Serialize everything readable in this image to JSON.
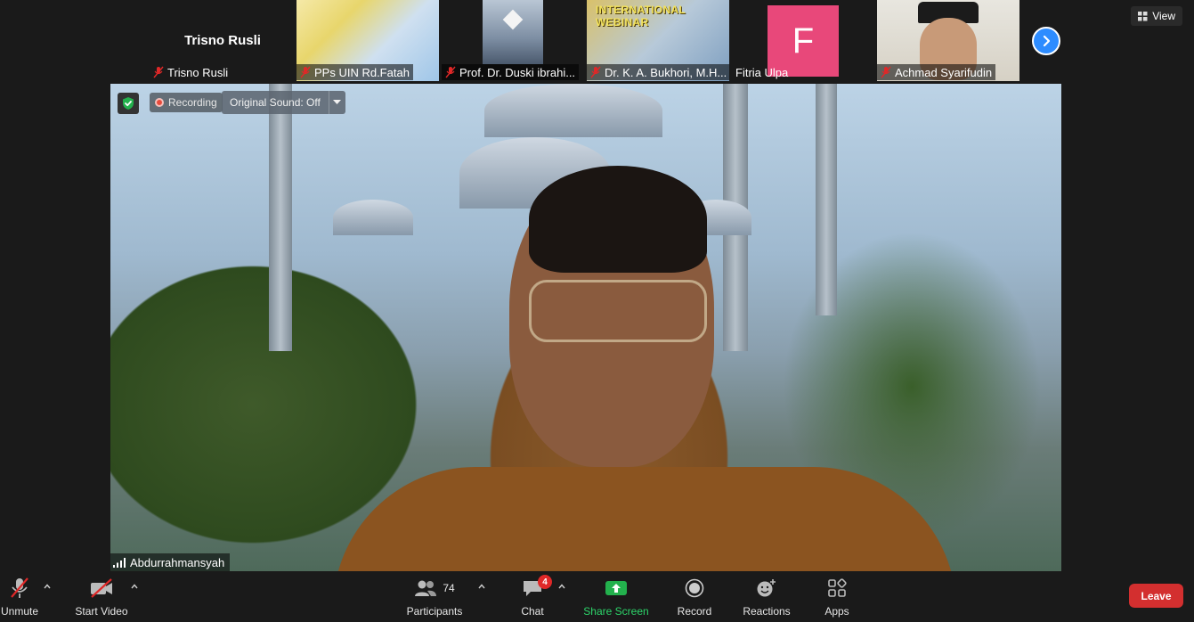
{
  "top_strip": {
    "participants": [
      {
        "name": "Trisno Rusli",
        "display": "Trisno Rusli",
        "muted": true
      },
      {
        "name": "PPs UIN Rd.Fatah",
        "muted": true
      },
      {
        "name": "Prof. Dr. Duski ibrahi...",
        "muted": true
      },
      {
        "name": "Dr. K. A. Bukhori, M.H...",
        "muted": true,
        "banner": "INTERNATIONAL WEBINAR"
      },
      {
        "name": "Fitria Ulpa",
        "muted": false,
        "avatar_letter": "F"
      },
      {
        "name": "Achmad Syarifudin",
        "muted": true
      }
    ],
    "next_icon": "chevron-right-icon",
    "view_label": "View"
  },
  "stage": {
    "recording_label": "Recording",
    "original_sound_label": "Original Sound: Off",
    "speaker_name": "Abdurrahmansyah",
    "security_icon": "shield-check-icon"
  },
  "toolbar": {
    "unmute_label": "Unmute",
    "start_video_label": "Start Video",
    "participants_label": "Participants",
    "participants_count": "74",
    "chat_label": "Chat",
    "chat_badge": "4",
    "share_screen_label": "Share Screen",
    "record_label": "Record",
    "reactions_label": "Reactions",
    "apps_label": "Apps",
    "leave_label": "Leave"
  },
  "colors": {
    "accent_blue": "#2d8cff",
    "leave_red": "#d32f2f",
    "share_green": "#2dd56a",
    "mute_red": "#e02828",
    "avatar_pink": "#e8487a"
  }
}
